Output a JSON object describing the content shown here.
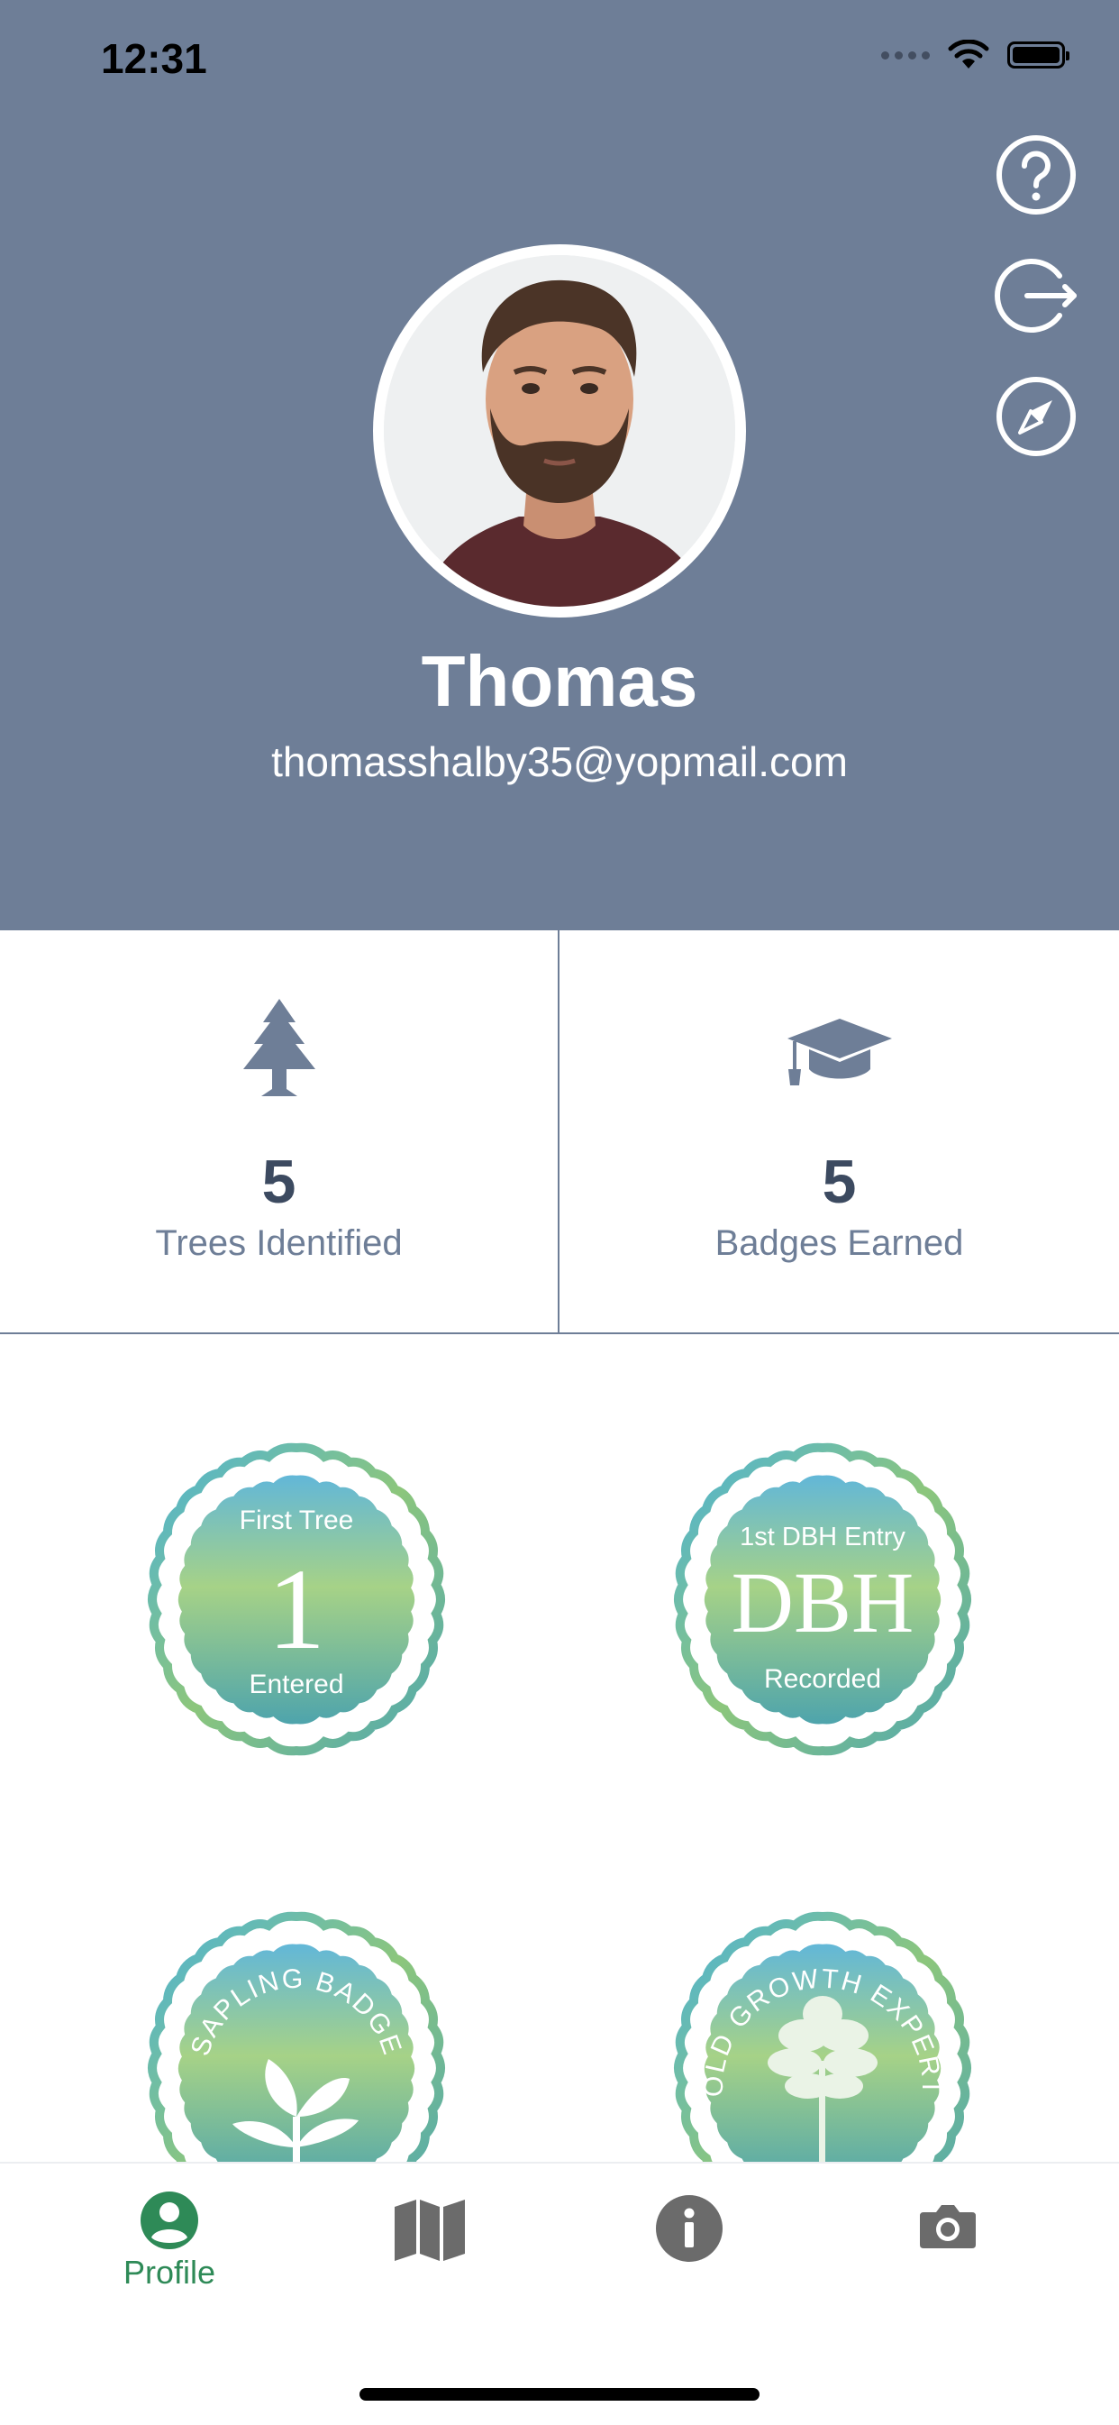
{
  "status_bar": {
    "time": "12:31"
  },
  "profile": {
    "name": "Thomas",
    "email": "thomasshalby35@yopmail.com"
  },
  "stats": [
    {
      "value": "5",
      "label": "Trees Identified",
      "icon": "tree-icon"
    },
    {
      "value": "5",
      "label": "Badges Earned",
      "icon": "graduation-cap-icon"
    }
  ],
  "badges": [
    {
      "top": "First Tree",
      "main": "1",
      "bottom": "Entered"
    },
    {
      "top": "1st DBH Entry",
      "main": "DBH",
      "bottom": "Recorded"
    },
    {
      "arc": "SAPLING BADGE"
    },
    {
      "arc": "OLD GROWTH EXPERT"
    }
  ],
  "tabbar": {
    "profile_label": "Profile"
  },
  "colors": {
    "header": "#6e7e97",
    "accent": "#2e8a57",
    "icon_gray": "#6b6b6b"
  }
}
